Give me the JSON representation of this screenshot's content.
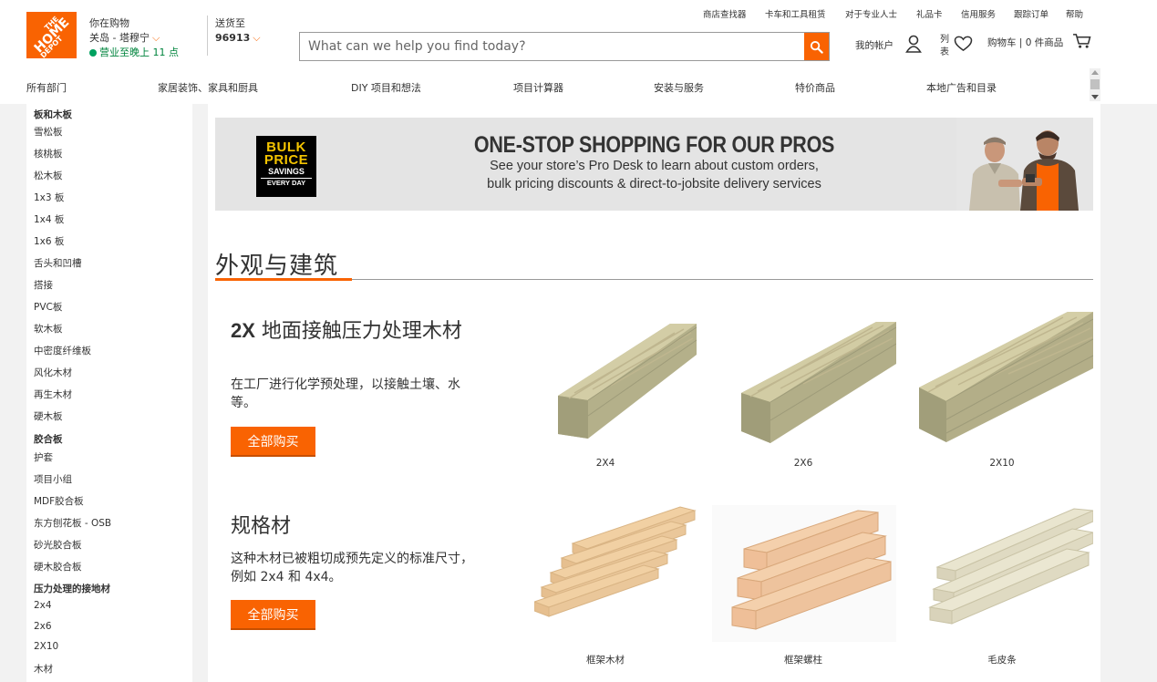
{
  "logo": {
    "line1": "THE",
    "line2": "HOME",
    "line3": "DEPOT"
  },
  "store": {
    "label": "你在购物",
    "location": "关岛 - 塔穆宁",
    "hours": "营业至晚上 11 点"
  },
  "delivery": {
    "label": "送货至",
    "zip": "96913"
  },
  "search": {
    "placeholder": "What can we help you find today?"
  },
  "utility_links": [
    "商店查找器",
    "卡车和工具租赁",
    "对于专业人士",
    "礼品卡",
    "信用服务",
    "跟踪订单",
    "帮助"
  ],
  "account": {
    "label": "我的帐户",
    "list_label": "列表",
    "cart_label": "购物车 | 0 件商品"
  },
  "nav": [
    "所有部门",
    "家居装饰、家具和厨具",
    "DIY 项目和想法",
    "项目计算器",
    "安装与服务",
    "特价商品",
    "本地广告和目录"
  ],
  "sidebar": [
    {
      "label": "板和木板",
      "header": true
    },
    {
      "label": "雪松板"
    },
    {
      "label": "核桃板"
    },
    {
      "label": "松木板"
    },
    {
      "label": "1x3 板"
    },
    {
      "label": "1x4 板"
    },
    {
      "label": "1x6 板"
    },
    {
      "label": "舌头和凹槽"
    },
    {
      "label": "搭接"
    },
    {
      "label": "PVC板"
    },
    {
      "label": "软木板"
    },
    {
      "label": "中密度纤维板"
    },
    {
      "label": "风化木材"
    },
    {
      "label": "再生木材"
    },
    {
      "label": "硬木板"
    },
    {
      "label": "胶合板",
      "header": true
    },
    {
      "label": "护套"
    },
    {
      "label": "项目小组"
    },
    {
      "label": "MDF胶合板"
    },
    {
      "label": "东方刨花板 - OSB"
    },
    {
      "label": "砂光胶合板"
    },
    {
      "label": "硬木胶合板"
    },
    {
      "label": "压力处理的接地材",
      "header": true
    },
    {
      "label": "2x4"
    },
    {
      "label": "2x6"
    },
    {
      "label": "2X10"
    },
    {
      "label": "木材"
    }
  ],
  "banner": {
    "badge": {
      "line1": "BULK",
      "line2": "PRICE",
      "line3": "SAVINGS",
      "line4": "EVERY DAY"
    },
    "title": "ONE-STOP SHOPPING FOR OUR PROS",
    "line1": "See your store’s Pro Desk to learn about custom orders,",
    "line2": "bulk pricing discounts & direct-to-jobsite delivery services"
  },
  "section": {
    "title": "外观与建筑"
  },
  "categories": [
    {
      "title_bold": "2X",
      "title_rest": " 地面接触压力处理木材",
      "description": "在工厂进行化学预处理，以接触土壤、水等。",
      "button": "全部购买",
      "products": [
        "2X4",
        "2X6",
        "2X10"
      ]
    },
    {
      "title_bold": "",
      "title_rest": "规格材",
      "description": "这种木材已被粗切成预先定义的标准尺寸，例如 2x4 和 4x4。",
      "button": "全部购买",
      "products": [
        "框架木材",
        "框架螺柱",
        "毛皮条"
      ]
    }
  ],
  "colors": {
    "brand": "#f96302",
    "open_status": "#00843d"
  }
}
